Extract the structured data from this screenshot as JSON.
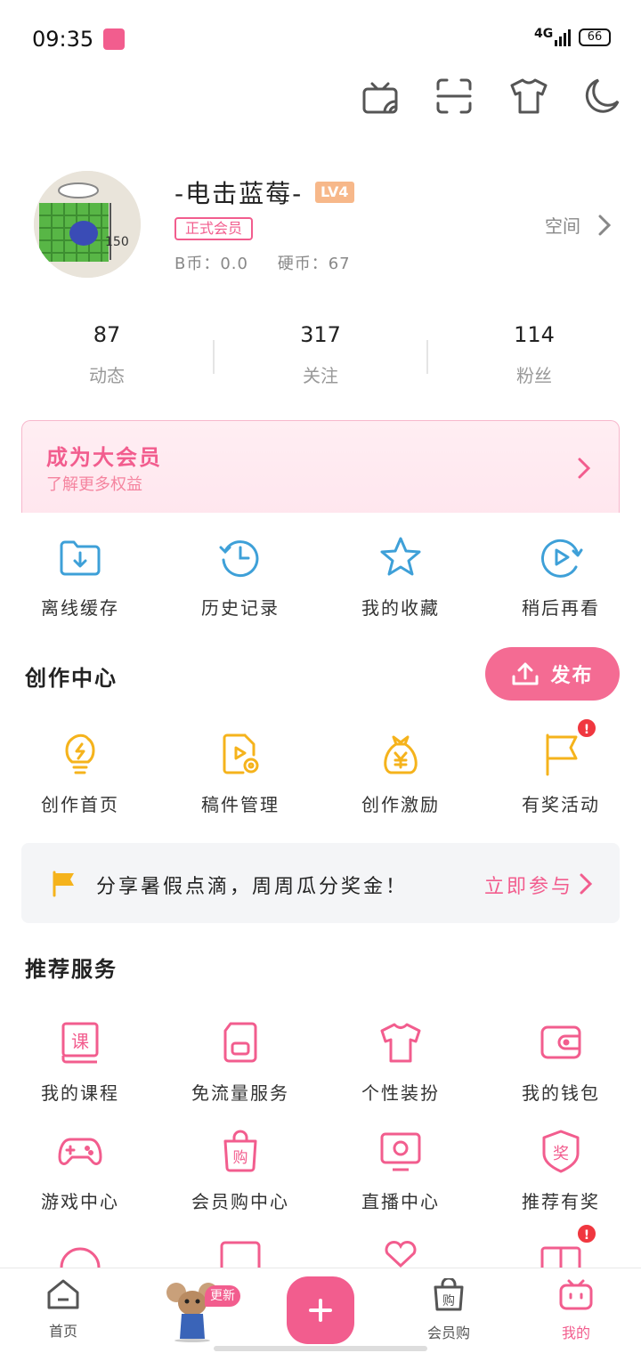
{
  "status_bar": {
    "time": "09:35",
    "network": "4G",
    "battery": "66"
  },
  "top_icons": [
    "tv-cast-icon",
    "scan-icon",
    "tshirt-icon",
    "moon-icon"
  ],
  "profile": {
    "username": "-电击蓝莓-",
    "level": "LV4",
    "vip_label": "正式会员",
    "b_coin": "B币：0.0",
    "coin": "硬币：67",
    "space_label": "空间"
  },
  "stats": [
    {
      "num": "87",
      "label": "动态"
    },
    {
      "num": "317",
      "label": "关注"
    },
    {
      "num": "114",
      "label": "粉丝"
    }
  ],
  "vip_banner": {
    "title": "成为大会员",
    "subtitle": "了解更多权益"
  },
  "quick_actions": [
    {
      "label": "离线缓存",
      "icon": "download-folder-icon"
    },
    {
      "label": "历史记录",
      "icon": "history-clock-icon"
    },
    {
      "label": "我的收藏",
      "icon": "star-icon"
    },
    {
      "label": "稍后再看",
      "icon": "watch-later-icon"
    }
  ],
  "creation": {
    "title": "创作中心",
    "publish_label": "发布",
    "items": [
      {
        "label": "创作首页",
        "icon": "lightbulb-icon"
      },
      {
        "label": "稿件管理",
        "icon": "manuscript-icon"
      },
      {
        "label": "创作激励",
        "icon": "money-bag-icon"
      },
      {
        "label": "有奖活动",
        "icon": "flag-icon",
        "badge": "!"
      }
    ]
  },
  "promo": {
    "text": "分享暑假点滴，周周瓜分奖金！",
    "link": "立即参与"
  },
  "services": {
    "title": "推荐服务",
    "items": [
      {
        "label": "我的课程",
        "icon": "course-icon"
      },
      {
        "label": "免流量服务",
        "icon": "sim-card-icon"
      },
      {
        "label": "个性装扮",
        "icon": "tshirt-icon"
      },
      {
        "label": "我的钱包",
        "icon": "wallet-icon"
      },
      {
        "label": "游戏中心",
        "icon": "gamepad-icon"
      },
      {
        "label": "会员购中心",
        "icon": "shopping-bag-icon"
      },
      {
        "label": "直播中心",
        "icon": "live-tv-icon"
      },
      {
        "label": "推荐有奖",
        "icon": "reward-icon"
      }
    ]
  },
  "bottom_nav": [
    {
      "label": "首页",
      "icon": "home-icon"
    },
    {
      "label": "",
      "icon": "mascot-avatar-icon",
      "badge": "更新"
    },
    {
      "label": "",
      "icon": "plus-icon"
    },
    {
      "label": "会员购",
      "icon": "shopping-bag-icon"
    },
    {
      "label": "我的",
      "icon": "tv-mascot-icon",
      "active": true
    }
  ],
  "colors": {
    "brand_pink": "#f25d8e",
    "blue_icon": "#3ea0d8",
    "yellow_icon": "#f5b31c"
  }
}
